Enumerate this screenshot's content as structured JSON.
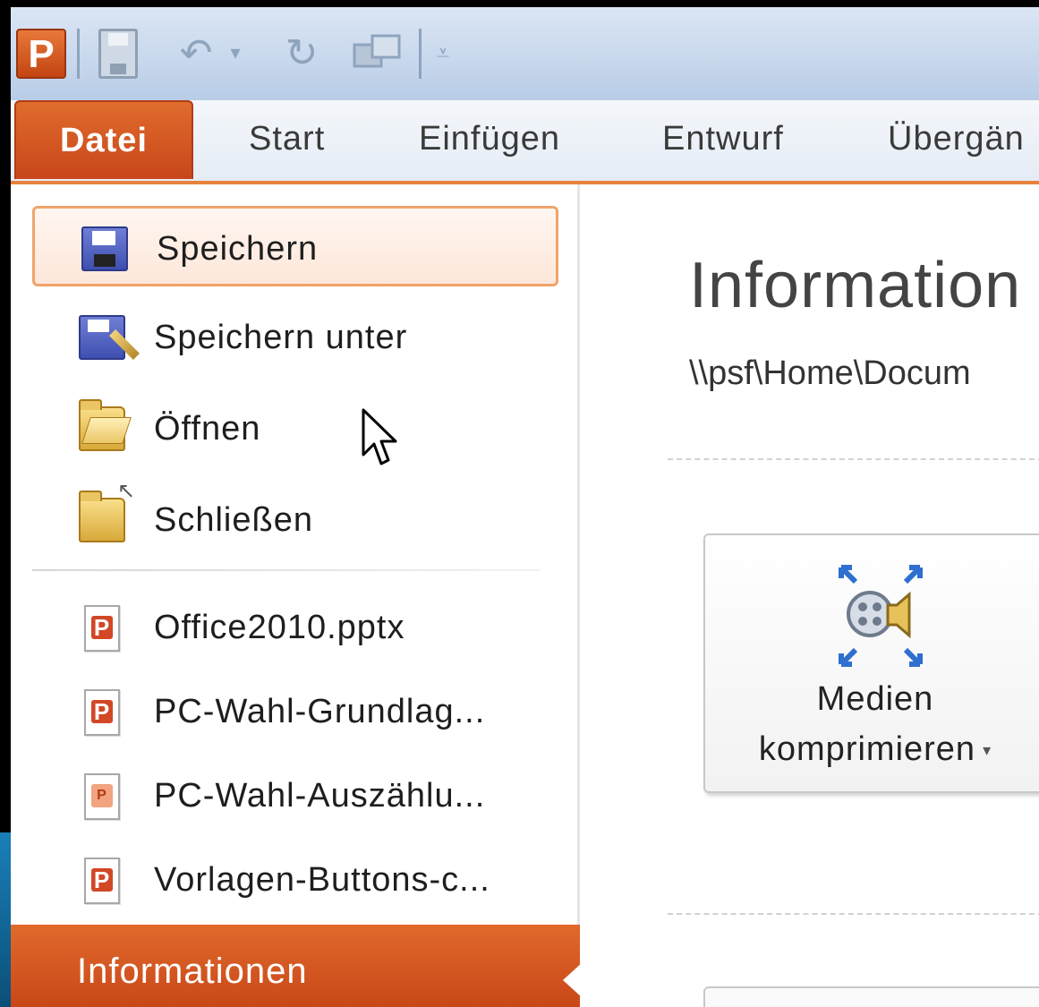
{
  "app": {
    "icon_letter": "P"
  },
  "quick_access": {
    "items": [
      "app-icon",
      "save-icon",
      "undo-icon",
      "redo-icon",
      "slideshow-icon",
      "customize-icon"
    ]
  },
  "tabs": [
    {
      "label": "Datei",
      "active": true
    },
    {
      "label": "Start"
    },
    {
      "label": "Einfügen"
    },
    {
      "label": "Entwurf"
    },
    {
      "label": "Übergän"
    }
  ],
  "menu": {
    "commands": [
      {
        "label": "Speichern",
        "icon": "save-icon",
        "hover": true
      },
      {
        "label": "Speichern unter",
        "icon": "save-as-icon"
      },
      {
        "label": "Öffnen",
        "icon": "open-folder-icon"
      },
      {
        "label": "Schließen",
        "icon": "close-folder-icon"
      }
    ],
    "recent_files": [
      {
        "label": "Office2010.pptx",
        "icon": "pptx-file-icon"
      },
      {
        "label": "PC-Wahl-Grundlag...",
        "icon": "pptx-file-icon"
      },
      {
        "label": "PC-Wahl-Auszählu...",
        "icon": "ppt-file-icon"
      },
      {
        "label": "Vorlagen-Buttons-c...",
        "icon": "pptx-file-icon"
      }
    ],
    "footer_label": "Informationen"
  },
  "info": {
    "title": "Information",
    "path": "\\\\psf\\Home\\Docum",
    "media_button": {
      "line1": "Medien",
      "line2": "komprimieren",
      "dropdown": "▾"
    }
  },
  "colors": {
    "accent": "#d0521e",
    "hover_border": "#f0a46b",
    "ribbon_bg": "#dbe6f4"
  }
}
